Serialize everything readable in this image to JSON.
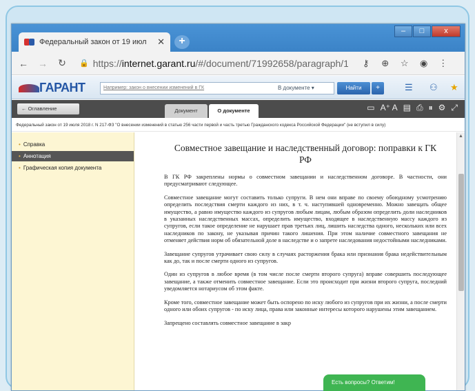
{
  "browser": {
    "tab_title": "Федеральный закон от 19 июл",
    "tab_close": "✕",
    "new_tab": "+",
    "url_prefix": "https://",
    "url_domain": "internet.garant.ru",
    "url_path": "/#/document/71992658/paragraph/1:9",
    "window_controls": [
      "–",
      "□",
      "x"
    ]
  },
  "garant_toolbar": {
    "logo_text": "ГАРАНТ",
    "search_placeholder": "Например: закон о внесении изменений в ГК",
    "scope_select": "В документе",
    "find_button": "Найти",
    "plus_button": "+"
  },
  "doc_tabs": {
    "toc_button": "Оглавление",
    "tab_document": "Документ",
    "tab_about": "О документе",
    "font_controls": "A⁺ A"
  },
  "info_line": "Федеральный закон от 19 июля 2018 г. N 217-ФЗ \"О внесении изменений в статью 256 части первой и часть третью Гражданского кодекса Российской Федерации\" (не вступил в силу)",
  "sidebar": {
    "items": [
      {
        "label": "Справка"
      },
      {
        "label": "Аннотация"
      },
      {
        "label": "Графическая копия документа"
      }
    ]
  },
  "article": {
    "title": "Совместное завещание и наследственный договор: поправки к ГК РФ",
    "paragraphs": [
      "В ГК РФ закреплены нормы о совместном завещании и наследственном договоре. В частности, они предусматривают следующее.",
      "Совместное завещание могут составить только супруги. В нем они вправе по своему обоюдному усмотрению определить последствия смерти каждого из них, в т. ч. наступившей одновременно. Можно завещать общее имущество, а равно имущество каждого из супругов любым лицам, любым образом определить доли наследников в указанных наследственных массах, определить имущество, входящее в наследственную массу каждого из супругов, если такое определение не нарушает прав третьих лиц, лишить наследства одного, нескольких или всех наследников по закону, не указывая причин такого лишения. При этом наличие совместного завещания не отменяет действия норм об обязательной доле в наследстве и о запрете наследования недостойными наследниками.",
      "Завещание супругов утрачивает свою силу в случаях расторжения брака или признания брака недействительным как до, так и после смерти одного из супругов.",
      "Один из супругов в любое время (в том числе после смерти второго супруга) вправе совершить последующее завещание, а также отменить совместное завещание. Если это происходит при жизни второго супруга, последний уведомляется нотариусом об этом факте.",
      "Кроме того, совместное завещание может быть оспорено по иску любого из супругов при их жизни, а после смерти одного или обоих супругов - по иску лица, права или законные интересы которого нарушены этим завещанием.",
      "Запрещено составлять совместное завещание в закр"
    ]
  },
  "chat_button": "Есть вопросы? Ответим!"
}
